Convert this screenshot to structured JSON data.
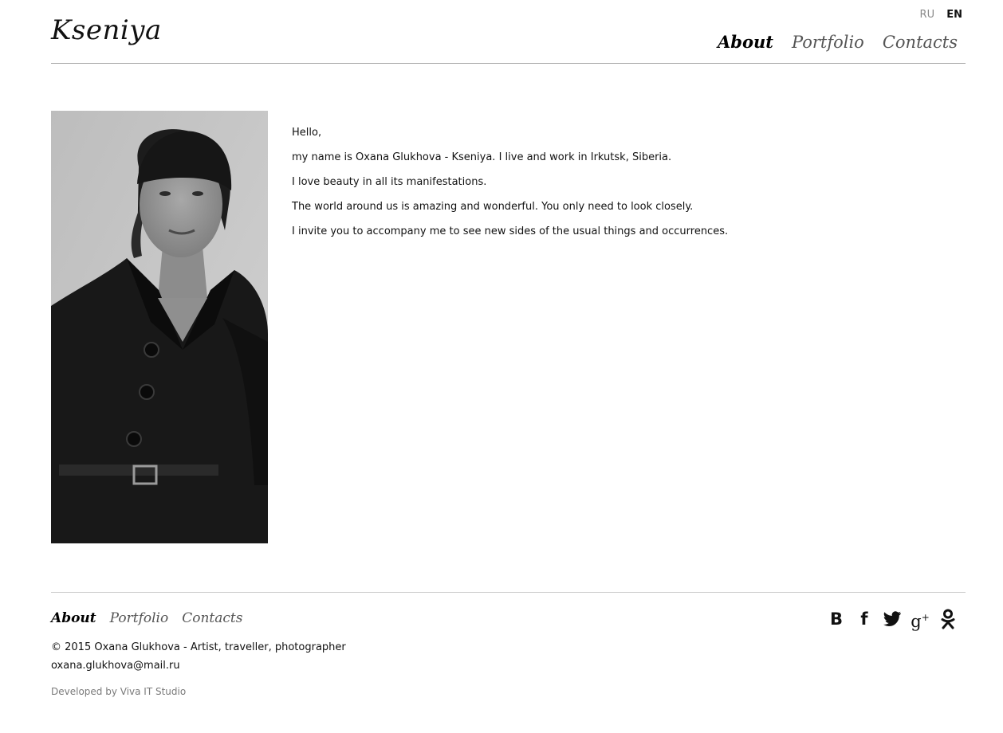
{
  "header": {
    "logo": "Kseniya",
    "languages": {
      "ru": "RU",
      "en": "EN"
    },
    "nav": [
      {
        "label": "About",
        "active": true
      },
      {
        "label": "Portfolio",
        "active": false
      },
      {
        "label": "Contacts",
        "active": false
      }
    ]
  },
  "main": {
    "bio": [
      "Hello,",
      "my name is Oxana Glukhova - Kseniya. I live and work in Irkutsk, Siberia.",
      "I love beauty in all its manifestations.",
      "The world around us is amazing and wonderful. You only need to look closely.",
      "I invite you to accompany me to see new sides of the usual things and occurrences."
    ]
  },
  "footer": {
    "nav": [
      {
        "label": "About",
        "active": true
      },
      {
        "label": "Portfolio",
        "active": false
      },
      {
        "label": "Contacts",
        "active": false
      }
    ],
    "copyright": "© 2015 Oxana Glukhova - Artist, traveller, photographer",
    "email": "oxana.glukhova@mail.ru",
    "developer": "Developed by Viva IT Studio",
    "social": [
      {
        "icon": "vk-icon",
        "glyph": "B"
      },
      {
        "icon": "facebook-icon",
        "glyph": "f"
      },
      {
        "icon": "twitter-icon"
      },
      {
        "icon": "google-plus-icon",
        "glyph": "g",
        "sup": "+"
      },
      {
        "icon": "odnoklassniki-icon"
      }
    ]
  },
  "colors": {
    "text": "#1a1a1a",
    "muted": "#7a7a7a",
    "divider": "#a9a9a9",
    "background": "#ffffff"
  }
}
